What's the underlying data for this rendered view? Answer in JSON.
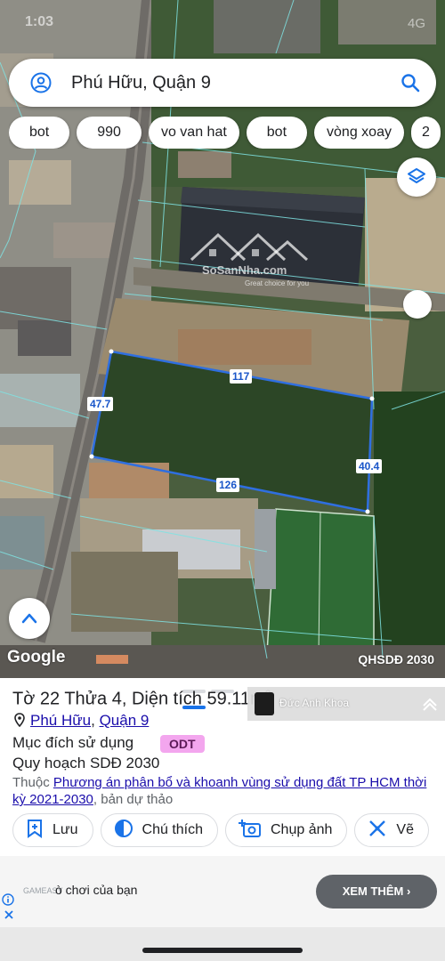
{
  "status": {
    "time": "1:03",
    "right": "4G"
  },
  "search": {
    "query": "Phú Hữu, Quận 9"
  },
  "chips": [
    "bot",
    "990",
    "vo van hat",
    "bot",
    "vòng xoay",
    "2"
  ],
  "watermark": {
    "brand": "SoSanNha.com",
    "tagline": "Great choice for you"
  },
  "parcel": {
    "north": "117",
    "west": "47.7",
    "south": "126",
    "east": "40.4",
    "outline_color": "#2f6fe0"
  },
  "map": {
    "google_label": "Google",
    "plan_label": "QHSDĐ 2030"
  },
  "sheet": {
    "title_main": "Tờ 22 Thửa 4, Diện tích 59",
    "title_tail": "11m",
    "title_sup": "2",
    "video_user": "Đức Anh Khoa",
    "ward": "Phú Hữu",
    "separator": ",",
    "district": "Quận 9",
    "purpose_label": "Mục đích sử dụng",
    "purpose_code": "ODT",
    "planning": "Quy hoạch SDĐ 2030",
    "desc_prefix": "Thuộc ",
    "desc_link": "Phương án phân bổ và khoanh vùng sử dụng đất TP HCM thời kỳ 2021-2030",
    "desc_suffix": ", bản dự thảo",
    "actions": [
      "Lưu",
      "Chú thích",
      "Chụp ảnh",
      "Vẽ"
    ]
  },
  "ad": {
    "brand": "GAMEASY",
    "text": "ò chơi của bạn",
    "button": "XEM THÊM"
  },
  "colors": {
    "accent": "#1a73e8",
    "badge": "#f3a6ee",
    "link": "#1a0dab"
  }
}
